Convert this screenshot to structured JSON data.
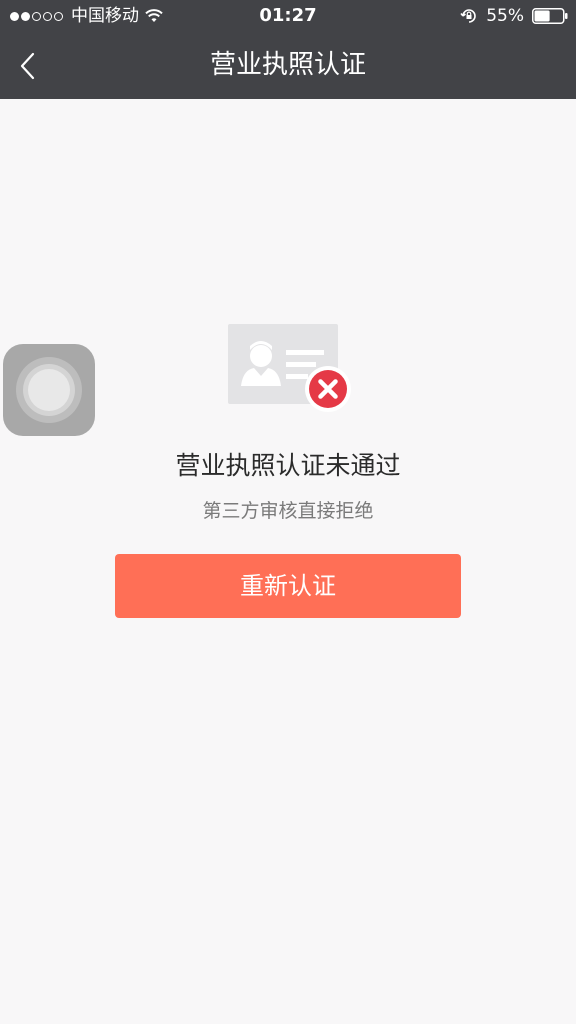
{
  "status_bar": {
    "carrier": "中国移动",
    "time": "01:27",
    "battery": "55%",
    "battery_level": 0.55,
    "signal_strength": 2,
    "signal_total": 5
  },
  "nav": {
    "title": "营业执照认证"
  },
  "result": {
    "title": "营业执照认证未通过",
    "subtitle": "第三方审核直接拒绝",
    "action_label": "重新认证"
  },
  "colors": {
    "header_bg": "#424347",
    "accent": "#ff6f56",
    "error_badge": "#e53946"
  },
  "icons": [
    "chevron-left-icon",
    "wifi-icon",
    "rotation-lock-icon",
    "battery-icon",
    "id-card-icon",
    "error-x-icon",
    "assistive-touch-icon"
  ]
}
